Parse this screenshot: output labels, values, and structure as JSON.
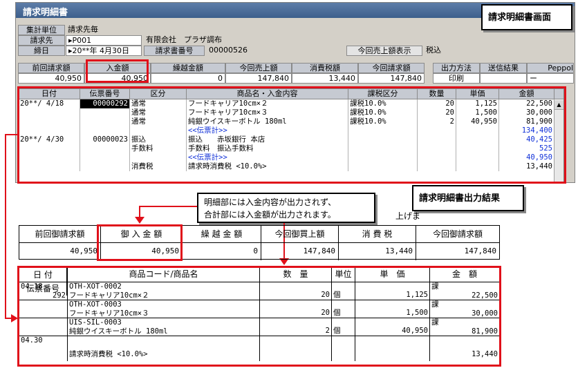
{
  "window": {
    "title": "請求明細書"
  },
  "form": {
    "group_label": "集計単位",
    "group_value": "請求先毎",
    "customer_label": "請求先",
    "customer_code": "P001",
    "customer_name": "有限会社　プラザ調布",
    "close_label": "締日",
    "close_date": "20**年 4月30日",
    "invoice_no_label": "請求書番号",
    "invoice_no": "00000526",
    "show_sales_button": "今回売上額表示",
    "tax_incl": "税込"
  },
  "summary": {
    "headers": [
      "前回請求額",
      "入金額",
      "繰越金額",
      "今回売上額",
      "消費税額",
      "今回請求額"
    ],
    "values": [
      "40,950",
      "40,950",
      "0",
      "147,840",
      "13,440",
      "147,840"
    ],
    "output_method_label": "出力方法",
    "output_method_value": "印刷",
    "send_result_label": "送信結果",
    "send_result_value": "",
    "peppol_label": "Peppol",
    "peppol_value": "ー"
  },
  "grid": {
    "columns": [
      "日付",
      "伝票番号",
      "区分",
      "商品名・入金内容",
      "課税区分",
      "数量",
      "単価",
      "金額"
    ],
    "rows": [
      {
        "date": "20**/ 4/18",
        "slip": "00000292",
        "kind": "通常",
        "name": "フードキャリア10cm×２",
        "tax": "課税10.0%",
        "qty": "20",
        "price": "1,125",
        "amount": "22,500",
        "blue": false
      },
      {
        "date": "",
        "slip": "",
        "kind": "通常",
        "name": "フードキャリア10cm×３",
        "tax": "課税10.0%",
        "qty": "20",
        "price": "1,500",
        "amount": "30,000",
        "blue": false
      },
      {
        "date": "",
        "slip": "",
        "kind": "通常",
        "name": "純銀ウイスキーボトル 180ml",
        "tax": "課税10.0%",
        "qty": "2",
        "price": "40,950",
        "amount": "81,900",
        "blue": false
      },
      {
        "date": "",
        "slip": "",
        "kind": "",
        "name": "<<伝票計>>",
        "tax": "",
        "qty": "",
        "price": "",
        "amount": "134,400",
        "blue": true
      },
      {
        "date": "20**/ 4/30",
        "slip": "00000023",
        "kind": "振込",
        "name": "振込　　赤坂銀行 本店",
        "tax": "",
        "qty": "",
        "price": "",
        "amount": "40,425",
        "blue": false,
        "amount_blue": true
      },
      {
        "date": "",
        "slip": "",
        "kind": "手数料",
        "name": "手数料　振込手数料",
        "tax": "",
        "qty": "",
        "price": "",
        "amount": "525",
        "blue": false,
        "amount_blue": true
      },
      {
        "date": "",
        "slip": "",
        "kind": "",
        "name": "<<伝票計>>",
        "tax": "",
        "qty": "",
        "price": "",
        "amount": "40,950",
        "blue": true
      },
      {
        "date": "",
        "slip": "",
        "kind": "消費税",
        "name": "請求時消費税 <10.0%>",
        "tax": "",
        "qty": "",
        "price": "",
        "amount": "13,440",
        "blue": false
      }
    ]
  },
  "notes": {
    "screen_label": "請求明細書画面",
    "output_label": "請求明細書出力結果",
    "callout_line1": "明細部には入金内容が出力されず、",
    "callout_line2": "合計部には入金額が出力されます。",
    "partial_text": "上げま"
  },
  "print_summary": {
    "headers": [
      "前回御請求額",
      "御 入 金 額",
      "繰 越 金 額",
      "今回御買上額",
      "消 費 税",
      "今回御請求額"
    ],
    "values": [
      "40,950",
      "40,950",
      "0",
      "147,840",
      "13,440",
      "147,840"
    ]
  },
  "print_detail": {
    "headers": {
      "date": "日 付",
      "slip": "伝票番号",
      "product": "商品コード/商品名",
      "qty": "数　量",
      "unit": "単位",
      "price": "単　価",
      "amount": "金　額"
    },
    "rows": [
      {
        "date": "04.18",
        "slip": "292",
        "code": "OTH-XOT-0002",
        "name": "フードキャリア10cm×２",
        "qty": "20",
        "unit": "個",
        "price": "1,125",
        "tax": "課",
        "amount": "22,500"
      },
      {
        "date": "",
        "slip": "",
        "code": "OTH-XOT-0003",
        "name": "フードキャリア10cm×３",
        "qty": "20",
        "unit": "個",
        "price": "1,500",
        "tax": "課",
        "amount": "30,000"
      },
      {
        "date": "",
        "slip": "",
        "code": "UIS-SIL-0003",
        "name": "純銀ウイスキーボトル 180ml",
        "qty": "2",
        "unit": "個",
        "price": "40,950",
        "tax": "課",
        "amount": "81,900"
      },
      {
        "date": "04.30",
        "slip": "",
        "code": "",
        "name": "請求時消費税 <10.0%>",
        "qty": "",
        "unit": "",
        "price": "",
        "tax": "",
        "amount": "13,440"
      }
    ]
  },
  "colors": {
    "accent_red": "#e0101a",
    "blue_text": "#1030d8",
    "title_bg": "#3d5f8c"
  }
}
